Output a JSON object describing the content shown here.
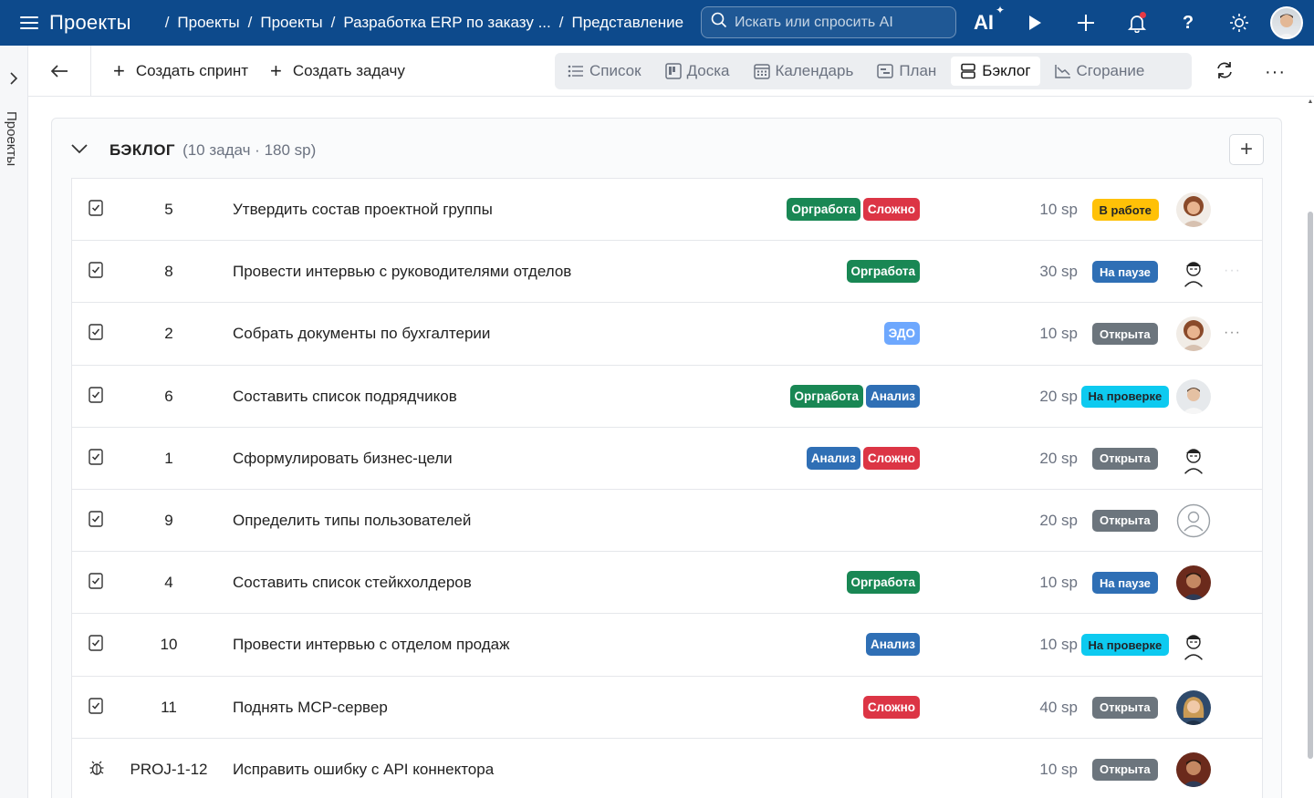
{
  "header": {
    "app_title": "Проекты",
    "breadcrumbs": [
      "Проекты",
      "Проекты",
      "Разработка ERP по заказу ...",
      "Представление"
    ],
    "search_placeholder": "Искать или спросить AI",
    "ai_label": "AI",
    "notification_dot": true
  },
  "rail": {
    "label": "Проекты"
  },
  "toolbar": {
    "create_sprint": "Создать спринт",
    "create_task": "Создать задачу",
    "views": [
      {
        "label": "Список",
        "icon": "list-icon",
        "active": false
      },
      {
        "label": "Доска",
        "icon": "board-icon",
        "active": false
      },
      {
        "label": "Календарь",
        "icon": "calendar-icon",
        "active": false
      },
      {
        "label": "План",
        "icon": "plan-icon",
        "active": false
      },
      {
        "label": "Бэклог",
        "icon": "backlog-icon",
        "active": true
      },
      {
        "label": "Сгорание",
        "icon": "burndown-icon",
        "active": false
      }
    ]
  },
  "backlog": {
    "title": "БЭКЛОГ",
    "meta": "(10 задач · 180 sp)",
    "rows": [
      {
        "type": "task",
        "key": "5",
        "title": "Утвердить состав проектной группы",
        "tags": [
          {
            "label": "Оргработа",
            "color": "#198754"
          },
          {
            "label": "Сложно",
            "color": "#dc3545"
          }
        ],
        "sp": "10 sp",
        "status": {
          "label": "В работе",
          "bg": "#ffc107",
          "fg": "#212529"
        },
        "avatar": "woman-curly",
        "more": ""
      },
      {
        "type": "task",
        "key": "8",
        "title": "Провести интервью с руководителями отделов",
        "tags": [
          {
            "label": "Оргработа",
            "color": "#198754"
          }
        ],
        "sp": "30 sp",
        "status": {
          "label": "На паузе",
          "bg": "#2f6fb5",
          "fg": "#ffffff"
        },
        "avatar": "man-sketch",
        "more": "···"
      },
      {
        "type": "task",
        "key": "2",
        "title": "Собрать документы по бухгалтерии",
        "tags": [
          {
            "label": "ЭДО",
            "color": "#6ea8fe"
          }
        ],
        "sp": "10 sp",
        "status": {
          "label": "Открыта",
          "bg": "#6c757d",
          "fg": "#ffffff"
        },
        "avatar": "woman-curly",
        "more": "···"
      },
      {
        "type": "task",
        "key": "6",
        "title": "Составить список подрядчиков",
        "tags": [
          {
            "label": "Оргработа",
            "color": "#198754"
          },
          {
            "label": "Анализ",
            "color": "#2f6fb5"
          }
        ],
        "sp": "20 sp",
        "status": {
          "label": "На проверке",
          "bg": "#0dcaf0",
          "fg": "#212529"
        },
        "avatar": "man-light",
        "more": ""
      },
      {
        "type": "task",
        "key": "1",
        "title": "Сформулировать бизнес-цели",
        "tags": [
          {
            "label": "Анализ",
            "color": "#2f6fb5"
          },
          {
            "label": "Сложно",
            "color": "#dc3545"
          }
        ],
        "sp": "20 sp",
        "status": {
          "label": "Открыта",
          "bg": "#6c757d",
          "fg": "#ffffff"
        },
        "avatar": "man-sketch",
        "more": ""
      },
      {
        "type": "task",
        "key": "9",
        "title": "Определить типы пользователей",
        "tags": [],
        "sp": "20 sp",
        "status": {
          "label": "Открыта",
          "bg": "#6c757d",
          "fg": "#ffffff"
        },
        "avatar": "unassigned",
        "more": ""
      },
      {
        "type": "task",
        "key": "4",
        "title": "Составить список стейкхолдеров",
        "tags": [
          {
            "label": "Оргработа",
            "color": "#198754"
          }
        ],
        "sp": "10 sp",
        "status": {
          "label": "На паузе",
          "bg": "#2f6fb5",
          "fg": "#ffffff"
        },
        "avatar": "man-dark",
        "more": ""
      },
      {
        "type": "task",
        "key": "10",
        "title": "Провести интервью с отделом продаж",
        "tags": [
          {
            "label": "Анализ",
            "color": "#2f6fb5"
          }
        ],
        "sp": "10 sp",
        "status": {
          "label": "На проверке",
          "bg": "#0dcaf0",
          "fg": "#212529"
        },
        "avatar": "man-sketch",
        "more": ""
      },
      {
        "type": "task",
        "key": "11",
        "title": "Поднять MCP-сервер",
        "tags": [
          {
            "label": "Сложно",
            "color": "#dc3545"
          }
        ],
        "sp": "40 sp",
        "status": {
          "label": "Открыта",
          "bg": "#6c757d",
          "fg": "#ffffff"
        },
        "avatar": "woman-blonde",
        "more": ""
      },
      {
        "type": "bug",
        "key": "PROJ-1-12",
        "title": "Исправить ошибку с API коннектора",
        "tags": [],
        "sp": "10 sp",
        "status": {
          "label": "Открыта",
          "bg": "#6c757d",
          "fg": "#ffffff"
        },
        "avatar": "man-dark",
        "more": ""
      }
    ]
  }
}
